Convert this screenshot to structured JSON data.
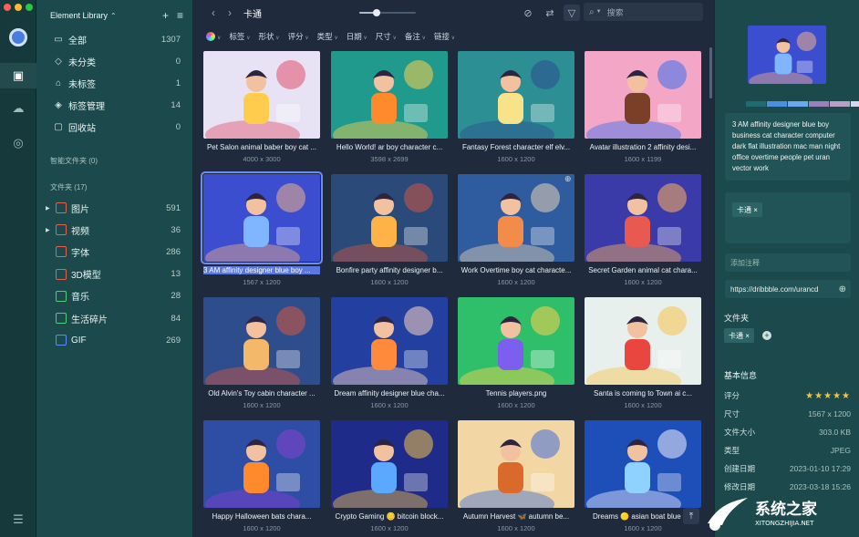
{
  "sidebar": {
    "library_name": "Element Library",
    "items": [
      {
        "icon": "inbox-icon",
        "label": "全部",
        "count": "1307"
      },
      {
        "icon": "box-icon",
        "label": "未分类",
        "count": "0"
      },
      {
        "icon": "tag-icon",
        "label": "未标签",
        "count": "1"
      },
      {
        "icon": "tags-icon",
        "label": "标签管理",
        "count": "14"
      },
      {
        "icon": "trash-icon",
        "label": "回收站",
        "count": "0"
      }
    ],
    "smart_folders_label": "智能文件夹 (0)",
    "folders_label": "文件夹 (17)",
    "folders": [
      {
        "label": "图片",
        "count": "591",
        "expandable": true,
        "color": "#e8604c"
      },
      {
        "label": "视频",
        "count": "36",
        "expandable": true,
        "color": "#e8604c"
      },
      {
        "label": "字体",
        "count": "286",
        "expandable": false,
        "color": "#e8604c"
      },
      {
        "label": "3D模型",
        "count": "13",
        "expandable": false,
        "color": "#e8604c"
      },
      {
        "label": "音乐",
        "count": "28",
        "expandable": false,
        "color": "#4bd07a"
      },
      {
        "label": "生活碎片",
        "count": "84",
        "expandable": false,
        "color": "#4bd07a"
      },
      {
        "label": "GIF",
        "count": "269",
        "expandable": false,
        "color": "#5b8cff"
      }
    ]
  },
  "toolbar": {
    "breadcrumb": "卡通",
    "zoom_level": 0.3,
    "search_placeholder": "搜索"
  },
  "filters": [
    "标签",
    "形状",
    "评分",
    "类型",
    "日期",
    "尺寸",
    "备注",
    "链接"
  ],
  "items": [
    {
      "name": "Pet Salon animal baber boy cat ...",
      "size": "4000 x 3000",
      "bg": "#e7e3f5",
      "accent": "#ffcc4d",
      "accent2": "#e34f6b",
      "emoji": ""
    },
    {
      "name": "Hello World! ar boy character c...",
      "size": "3598 x 2699",
      "bg": "#1f9a8c",
      "accent": "#ff8a2b",
      "accent2": "#ffd24d",
      "emoji": ""
    },
    {
      "name": "Fantasy Forest character elf elv...",
      "size": "1600 x 1200",
      "bg": "#2b8f94",
      "accent": "#f8e38a",
      "accent2": "#2f4d8f",
      "emoji": ""
    },
    {
      "name": "Avatar illustration 2 affinity desi...",
      "size": "1600 x 1199",
      "bg": "#f3a6c6",
      "accent": "#7a3f27",
      "accent2": "#3b6ff0",
      "emoji": ""
    },
    {
      "name": "3 AM affinity designer blue boy ...",
      "size": "1567 x 1200",
      "bg": "#3b4ecf",
      "accent": "#7fb6ff",
      "accent2": "#f1b08a",
      "emoji": "",
      "selected": true
    },
    {
      "name": "Bonfire party affinity designer b...",
      "size": "1600 x 1200",
      "bg": "#2a4a7a",
      "accent": "#ffb347",
      "accent2": "#d2563f",
      "emoji": ""
    },
    {
      "name": "Work Overtime boy cat characte...",
      "size": "1600 x 1200",
      "bg": "#2f5c9e",
      "accent": "#f28c4a",
      "accent2": "#e9d4b8",
      "emoji": ""
    },
    {
      "name": "Secret Garden animal cat chara...",
      "size": "1600 x 1200",
      "bg": "#3a3aa8",
      "accent": "#e85a4f",
      "accent2": "#ffb35c",
      "emoji": ""
    },
    {
      "name": "Old Alvin's Toy cabin character ...",
      "size": "1600 x 1200",
      "bg": "#2e4d8c",
      "accent": "#f4b86a",
      "accent2": "#d8573c",
      "emoji": ""
    },
    {
      "name": "Dream affinity designer blue cha...",
      "size": "1600 x 1200",
      "bg": "#2340a0",
      "accent": "#ff8a3c",
      "accent2": "#ffd6c2",
      "emoji": ""
    },
    {
      "name": "Tennis players.png",
      "size": "1600 x 1200",
      "bg": "#2fbf6a",
      "accent": "#7d5ff0",
      "accent2": "#ffd24d",
      "emoji": "🟢"
    },
    {
      "name": "Santa is coming to Town ai c...",
      "size": "1600 x 1200",
      "bg": "#e8f0ee",
      "accent": "#e8463f",
      "accent2": "#f6c34a",
      "emoji": "🍪"
    },
    {
      "name": "Happy Halloween bats chara...",
      "size": "1600 x 1200",
      "bg": "#2e4ea6",
      "accent": "#ff8a2b",
      "accent2": "#8a3fd0",
      "emoji": "🎃"
    },
    {
      "name": "Crypto Gaming 🪙 bitcoin block...",
      "size": "1600 x 1200",
      "bg": "#1f2b88",
      "accent": "#5aa8ff",
      "accent2": "#f0c44a",
      "emoji": ""
    },
    {
      "name": "Autumn Harvest 🦋 autumn be...",
      "size": "1600 x 1200",
      "bg": "#f2d6a4",
      "accent": "#d96a2b",
      "accent2": "#3f6ed8",
      "emoji": ""
    },
    {
      "name": "Dreams 🟡 asian boat blue b...",
      "size": "1600 x 1200",
      "bg": "#1e4fb8",
      "accent": "#8fd2ff",
      "accent2": "#f2f2ff",
      "emoji": ""
    }
  ],
  "inspector": {
    "palette": [
      "#1e6c6f",
      "#4a90e2",
      "#6aa8f0",
      "#9a7fb8",
      "#b6a0c8",
      "#d6d8f0"
    ],
    "description": "3 AM affinity designer blue boy business cat character computer dark flat illustration mac man night office overtime people pet uran vector work",
    "tags": [
      "卡通"
    ],
    "note_placeholder": "添加注释",
    "url": "https://dribbble.com/urancd",
    "folders_header": "文件夹",
    "folders": [
      "卡通"
    ],
    "info_header": "基本信息",
    "rating_label": "评分",
    "rating": 5,
    "info": [
      {
        "k": "尺寸",
        "v": "1567 x 1200"
      },
      {
        "k": "文件大小",
        "v": "303.0 KB"
      },
      {
        "k": "类型",
        "v": "JPEG"
      },
      {
        "k": "创建日期",
        "v": "2023-01-10 17:29"
      },
      {
        "k": "修改日期",
        "v": "2023-03-18 15:26"
      }
    ]
  },
  "watermark": {
    "title": "系统之家",
    "url": "XITONGZHIJIA.NET"
  }
}
